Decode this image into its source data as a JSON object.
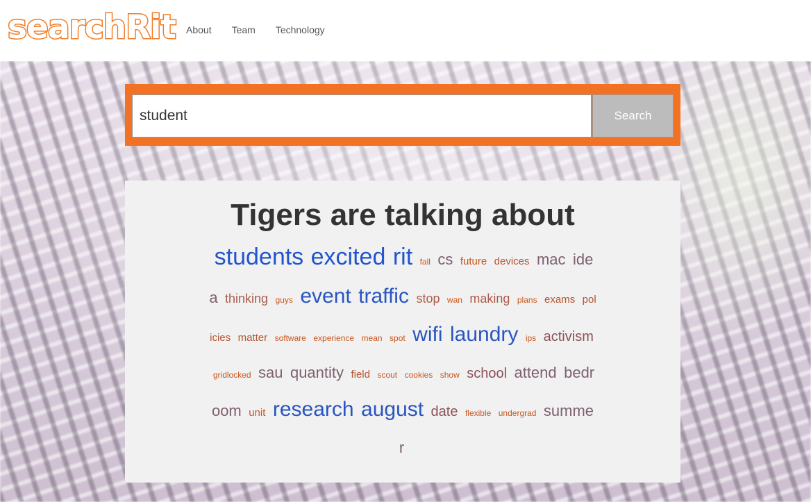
{
  "header": {
    "logo_text": "searchRit",
    "nav": [
      "About",
      "Team",
      "Technology"
    ]
  },
  "search": {
    "value": "student",
    "button_label": "Search",
    "accent_color": "#f37123"
  },
  "cloud": {
    "title": "Tigers are talking about",
    "words": [
      {
        "text": "students",
        "size": 34,
        "color": "#2255cc"
      },
      {
        "text": "excited",
        "size": 34,
        "color": "#2255cc"
      },
      {
        "text": "rit",
        "size": 34,
        "color": "#2255cc"
      },
      {
        "text": "fall",
        "size": 12,
        "color": "#c9571e"
      },
      {
        "text": "cs",
        "size": 22,
        "color": "#7d6070"
      },
      {
        "text": "future",
        "size": 15,
        "color": "#c9571e"
      },
      {
        "text": "devices",
        "size": 15,
        "color": "#b55530"
      },
      {
        "text": "mac",
        "size": 22,
        "color": "#7d6070"
      },
      {
        "text": "idea",
        "size": 22,
        "color": "#7d6070"
      },
      {
        "text": "thinking",
        "size": 18,
        "color": "#a95d4a"
      },
      {
        "text": "guys",
        "size": 12,
        "color": "#c9571e"
      },
      {
        "text": "event",
        "size": 30,
        "color": "#2a55c0"
      },
      {
        "text": "traffic",
        "size": 30,
        "color": "#2a55c0"
      },
      {
        "text": "stop",
        "size": 18,
        "color": "#a95d4a"
      },
      {
        "text": "wan",
        "size": 12,
        "color": "#c9571e"
      },
      {
        "text": "making",
        "size": 18,
        "color": "#a95d4a"
      },
      {
        "text": "plans",
        "size": 12,
        "color": "#c9571e"
      },
      {
        "text": "exams",
        "size": 15,
        "color": "#b55530"
      },
      {
        "text": "policies",
        "size": 15,
        "color": "#b55530"
      },
      {
        "text": "matter",
        "size": 15,
        "color": "#b55530"
      },
      {
        "text": "software",
        "size": 12,
        "color": "#c9571e"
      },
      {
        "text": "experience",
        "size": 12,
        "color": "#c9571e"
      },
      {
        "text": "mean",
        "size": 12,
        "color": "#c9571e"
      },
      {
        "text": "spot",
        "size": 12,
        "color": "#c9571e"
      },
      {
        "text": "wifi",
        "size": 30,
        "color": "#2a55c0"
      },
      {
        "text": "laundry",
        "size": 30,
        "color": "#2a55c0"
      },
      {
        "text": "ips",
        "size": 12,
        "color": "#c9571e"
      },
      {
        "text": "activism",
        "size": 20,
        "color": "#8c5258"
      },
      {
        "text": "gridlocked",
        "size": 12,
        "color": "#c9571e"
      },
      {
        "text": "sau",
        "size": 22,
        "color": "#7d6070"
      },
      {
        "text": "quantity",
        "size": 22,
        "color": "#7d6070"
      },
      {
        "text": "field",
        "size": 15,
        "color": "#b55530"
      },
      {
        "text": "scout",
        "size": 12,
        "color": "#c9571e"
      },
      {
        "text": "cookies",
        "size": 12,
        "color": "#c9571e"
      },
      {
        "text": "show",
        "size": 12,
        "color": "#c9571e"
      },
      {
        "text": "school",
        "size": 20,
        "color": "#8c5258"
      },
      {
        "text": "attend",
        "size": 22,
        "color": "#7d6070"
      },
      {
        "text": "bedroom",
        "size": 22,
        "color": "#7d6070"
      },
      {
        "text": "unit",
        "size": 15,
        "color": "#c9571e"
      },
      {
        "text": "research",
        "size": 30,
        "color": "#2a55c0"
      },
      {
        "text": "august",
        "size": 30,
        "color": "#2a55c0"
      },
      {
        "text": "date",
        "size": 20,
        "color": "#8c5258"
      },
      {
        "text": "flexible",
        "size": 12,
        "color": "#c9571e"
      },
      {
        "text": "undergrad",
        "size": 12,
        "color": "#c9571e"
      },
      {
        "text": "summer",
        "size": 22,
        "color": "#7d6070"
      }
    ]
  }
}
